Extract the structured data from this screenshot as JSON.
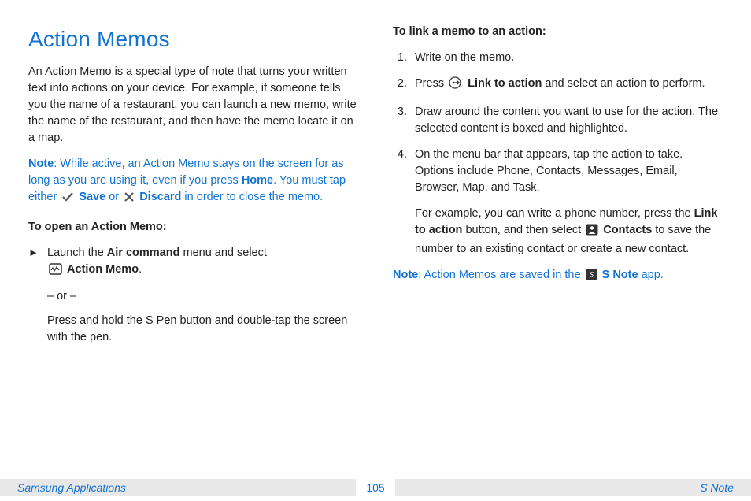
{
  "left": {
    "title": "Action Memos",
    "intro": "An Action Memo is a special type of note that turns your written text into actions on your device. For example, if someone tells you the name of a restaurant, you can launch a new memo, write the name of the restaurant, and then have the memo locate it on a map.",
    "note": {
      "label": "Note",
      "pre": ": While active, an Action Memo stays on the screen for as long as you are using it, even if you press ",
      "home": "Home",
      "mid": ". You must tap either ",
      "save": "Save",
      "or": " or ",
      "discard": "Discard",
      "post": " in order to close the memo."
    },
    "openhead": "To open an Action Memo:",
    "bullet": {
      "marker": "►",
      "pre": "Launch the ",
      "aircmd": "Air command",
      "mid": " menu and select ",
      "action": "Action Memo",
      "post": "."
    },
    "or": "– or –",
    "alt": "Press and hold the S Pen button and double-tap the screen with the pen."
  },
  "right": {
    "linkhead": "To link a memo to an action:",
    "steps": [
      {
        "n": "1.",
        "txt": "Write on the memo."
      },
      {
        "n": "2.",
        "pre": "Press ",
        "bold": "Link to action",
        "post": " and select an action to perform.",
        "icon": "link"
      },
      {
        "n": "3.",
        "txt": "Draw around the content you want to use for the action. The selected content is boxed and highlighted."
      },
      {
        "n": "4.",
        "txt": "On the menu bar that appears, tap the action to take. Options include Phone, Contacts, Messages, Email, Browser, Map, and Task."
      }
    ],
    "example": {
      "pre": "For example, you can write a phone number, press the ",
      "link": "Link to action",
      "mid": " button, and then select ",
      "contacts": "Contacts",
      "post": " to save the number to an existing contact or create a new contact."
    },
    "note2": {
      "label": "Note",
      "pre": ": Action Memos are saved in the ",
      "snote": "S Note",
      "post": " app."
    }
  },
  "footer": {
    "left": "Samsung Applications",
    "page": "105",
    "right": "S Note"
  }
}
